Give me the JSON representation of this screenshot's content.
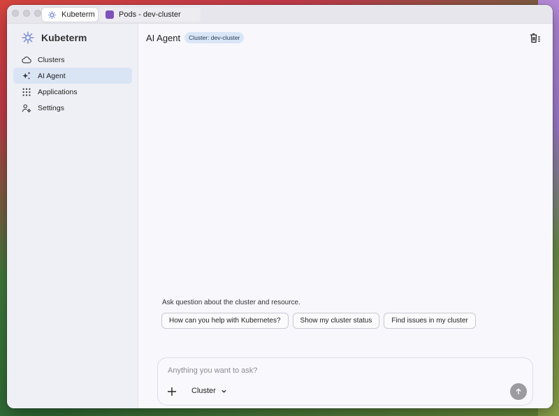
{
  "tabs": [
    {
      "label": "Kubeterm",
      "active": true
    },
    {
      "label": "Pods - dev-cluster",
      "active": false
    }
  ],
  "sidebar": {
    "brand": "Kubeterm",
    "items": [
      {
        "label": "Clusters",
        "icon": "cloud-icon",
        "selected": false
      },
      {
        "label": "AI Agent",
        "icon": "sparkles-icon",
        "selected": true
      },
      {
        "label": "Applications",
        "icon": "grid-icon",
        "selected": false
      },
      {
        "label": "Settings",
        "icon": "user-settings-icon",
        "selected": false
      }
    ]
  },
  "main": {
    "title": "AI Agent",
    "cluster_badge": "Cluster: dev-cluster",
    "prompt_hint": "Ask question about the cluster and resource.",
    "suggestions": [
      "How can you help with Kubernetes?",
      "Show my cluster status",
      "Find issues in my cluster"
    ],
    "composer": {
      "placeholder": "Anything you want to ask?",
      "context": "Cluster"
    }
  },
  "colors": {
    "selected_nav": "#d9e4f5",
    "badge": "#d9e6f7",
    "pod_tab_icon": "#7e52b8",
    "send_button": "#9b9ba0"
  }
}
